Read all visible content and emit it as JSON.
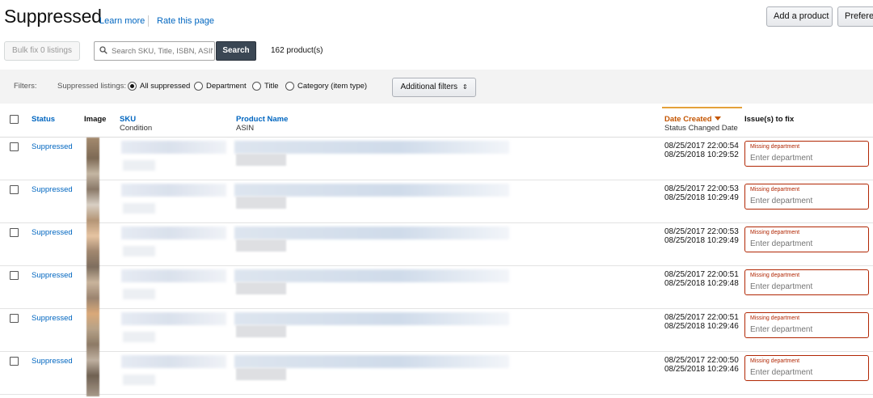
{
  "header": {
    "title": "Suppressed",
    "learn_more": "Learn more",
    "rate_page": "Rate this page",
    "add_product": "Add a product",
    "preferences": "Prefere"
  },
  "toolbar": {
    "bulk_fix": "Bulk fix 0 listings",
    "search_placeholder": "Search SKU, Title, ISBN, ASIN",
    "search_button": "Search",
    "product_count": "162 product(s)"
  },
  "filters": {
    "label": "Filters:",
    "group_label": "Suppressed listings:",
    "options": [
      "All suppressed",
      "Department",
      "Title",
      "Category (item type)"
    ],
    "selected": "All suppressed",
    "additional": "Additional filters"
  },
  "table": {
    "columns": {
      "status": "Status",
      "image": "Image",
      "sku": "SKU",
      "sku_sub": "Condition",
      "product_name": "Product Name",
      "product_sub": "ASIN",
      "date_created": "Date Created",
      "date_sub": "Status Changed Date",
      "issues": "Issue(s) to fix"
    },
    "rows": [
      {
        "status": "Suppressed",
        "date_created": "08/25/2017 22:00:54",
        "status_changed": "08/25/2018 10:29:52",
        "issue": "Missing department",
        "placeholder": "Enter department"
      },
      {
        "status": "Suppressed",
        "date_created": "08/25/2017 22:00:53",
        "status_changed": "08/25/2018 10:29:49",
        "issue": "Missing department",
        "placeholder": "Enter department"
      },
      {
        "status": "Suppressed",
        "date_created": "08/25/2017 22:00:53",
        "status_changed": "08/25/2018 10:29:49",
        "issue": "Missing department",
        "placeholder": "Enter department"
      },
      {
        "status": "Suppressed",
        "date_created": "08/25/2017 22:00:51",
        "status_changed": "08/25/2018 10:29:48",
        "issue": "Missing department",
        "placeholder": "Enter department"
      },
      {
        "status": "Suppressed",
        "date_created": "08/25/2017 22:00:51",
        "status_changed": "08/25/2018 10:29:46",
        "issue": "Missing department",
        "placeholder": "Enter department"
      },
      {
        "status": "Suppressed",
        "date_created": "08/25/2017 22:00:50",
        "status_changed": "08/25/2018 10:29:46",
        "issue": "Missing department",
        "placeholder": "Enter department"
      }
    ]
  }
}
